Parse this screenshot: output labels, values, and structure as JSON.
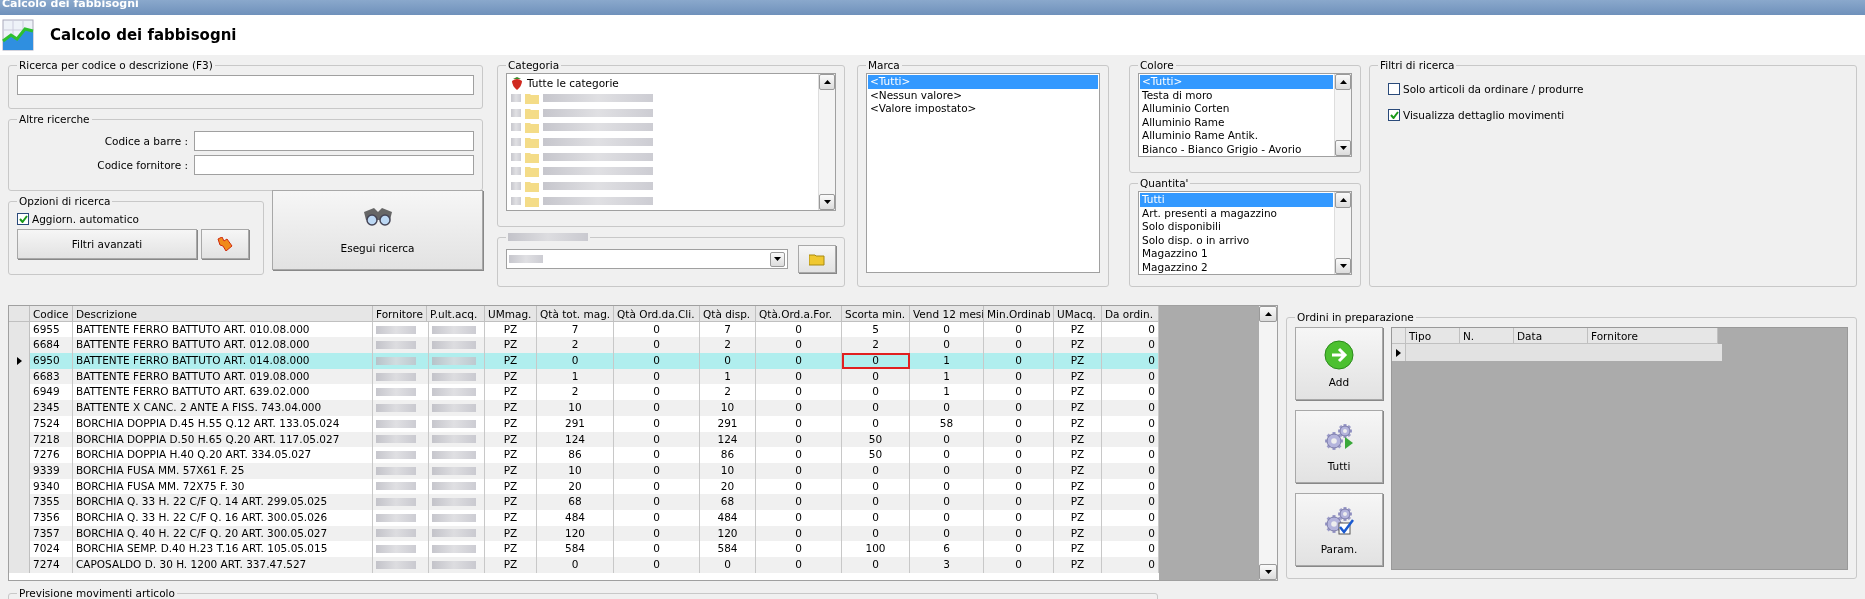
{
  "window": {
    "title": "Calcolo dei fabbisogni"
  },
  "header": {
    "title": "Calcolo dei fabbisogni"
  },
  "search": {
    "label": "Ricerca per codice o descrizione (F3)"
  },
  "other_searches": {
    "label": "Altre ricerche",
    "fields": [
      {
        "label": "Codice a barre :"
      },
      {
        "label": "Codice fornitore :"
      }
    ]
  },
  "search_options": {
    "label": "Opzioni di ricerca",
    "auto_update": {
      "label": "Aggiorn. automatico",
      "checked": true
    },
    "advanced_button": "Filtri avanzati"
  },
  "run_search_button": "Esegui ricerca",
  "category": {
    "label": "Categoria",
    "items": [
      {
        "kind": "root",
        "label": "Tutte le categorie"
      },
      {
        "kind": "redacted"
      },
      {
        "kind": "redacted"
      },
      {
        "kind": "redacted"
      },
      {
        "kind": "redacted"
      },
      {
        "kind": "redacted"
      },
      {
        "kind": "redacted"
      },
      {
        "kind": "redacted"
      },
      {
        "kind": "redacted"
      }
    ]
  },
  "brand": {
    "label": "Marca",
    "items": [
      {
        "label": "<Tutti>",
        "selected": true
      },
      {
        "label": "<Nessun valore>",
        "selected": false
      },
      {
        "label": "<Valore impostato>",
        "selected": false
      }
    ]
  },
  "color": {
    "label": "Colore",
    "items": [
      {
        "label": "<Tutti>",
        "selected": true
      },
      {
        "label": "Testa di moro",
        "selected": false
      },
      {
        "label": "Alluminio Corten",
        "selected": false
      },
      {
        "label": "Alluminio Rame",
        "selected": false
      },
      {
        "label": "Alluminio Rame Antik.",
        "selected": false
      },
      {
        "label": "Bianco - Bianco Grigio - Avorio",
        "selected": false
      }
    ]
  },
  "quantity": {
    "label": "Quantita'",
    "items": [
      {
        "label": "Tutti",
        "selected": true
      },
      {
        "label": "Art. presenti a magazzino",
        "selected": false
      },
      {
        "label": "Solo disponibili",
        "selected": false
      },
      {
        "label": "Solo disp. o in arrivo",
        "selected": false
      },
      {
        "label": "Magazzino 1",
        "selected": false
      },
      {
        "label": "Magazzino 2",
        "selected": false
      }
    ]
  },
  "search_filters": {
    "label": "Filtri di ricerca",
    "options": [
      {
        "label": "Solo articoli da ordinare / produrre",
        "checked": false
      },
      {
        "label": "Visualizza dettaglio movimenti",
        "checked": true
      }
    ]
  },
  "table": {
    "columns": [
      {
        "label": "Codice",
        "focused": false
      },
      {
        "label": "Descrizione",
        "focused": false
      },
      {
        "label": "Fornitore",
        "focused": false
      },
      {
        "label": "P.ult.acq.",
        "focused": false
      },
      {
        "label": "UMmag.",
        "focused": false
      },
      {
        "label": "Qtà tot. mag.",
        "focused": false
      },
      {
        "label": "Qtà Ord.da.Cli.",
        "focused": false
      },
      {
        "label": "Qtà disp.",
        "focused": false
      },
      {
        "label": "Qtà.Ord.a.For.",
        "focused": false
      },
      {
        "label": "Scorta min.",
        "focused": true
      },
      {
        "label": "Vend 12 mesi",
        "focused": false
      },
      {
        "label": "Min.Ordinab",
        "focused": false
      },
      {
        "label": "UMacq.",
        "focused": false
      },
      {
        "label": "Da ordin.",
        "focused": false
      }
    ],
    "rows": [
      {
        "selected": false,
        "cells": [
          "6955",
          "BATTENTE FERRO BATTUTO ART. 010.08.000",
          "",
          "",
          "PZ",
          "7",
          "0",
          "7",
          "0",
          "5",
          "0",
          "0",
          "PZ",
          "0"
        ]
      },
      {
        "selected": false,
        "cells": [
          "6684",
          "BATTENTE FERRO BATTUTO ART. 012.08.000",
          "",
          "",
          "PZ",
          "2",
          "0",
          "2",
          "0",
          "2",
          "0",
          "0",
          "PZ",
          "0"
        ]
      },
      {
        "selected": true,
        "cells": [
          "6950",
          "BATTENTE FERRO BATTUTO ART. 014.08.000",
          "",
          "",
          "PZ",
          "0",
          "0",
          "0",
          "0",
          "0",
          "1",
          "0",
          "PZ",
          "0"
        ]
      },
      {
        "selected": false,
        "cells": [
          "6683",
          "BATTENTE FERRO BATTUTO ART. 019.08.000",
          "",
          "",
          "PZ",
          "1",
          "0",
          "1",
          "0",
          "0",
          "1",
          "0",
          "PZ",
          "0"
        ]
      },
      {
        "selected": false,
        "cells": [
          "6949",
          "BATTENTE FERRO BATTUTO ART. 639.02.000",
          "",
          "",
          "PZ",
          "2",
          "0",
          "2",
          "0",
          "0",
          "1",
          "0",
          "PZ",
          "0"
        ]
      },
      {
        "selected": false,
        "cells": [
          "2345",
          "BATTENTE X CANC.  2 ANTE A FISS. 743.04.000",
          "",
          "",
          "PZ",
          "10",
          "0",
          "10",
          "0",
          "0",
          "0",
          "0",
          "PZ",
          "0"
        ]
      },
      {
        "selected": false,
        "cells": [
          "7524",
          "BORCHIA DOPPIA D.45 H.55 Q.12 ART. 133.05.024",
          "",
          "",
          "PZ",
          "291",
          "0",
          "291",
          "0",
          "0",
          "58",
          "0",
          "PZ",
          "0"
        ]
      },
      {
        "selected": false,
        "cells": [
          "7218",
          "BORCHIA DOPPIA D.50 H.65 Q.20 ART. 117.05.027",
          "",
          "",
          "PZ",
          "124",
          "0",
          "124",
          "0",
          "50",
          "0",
          "0",
          "PZ",
          "0"
        ]
      },
      {
        "selected": false,
        "cells": [
          "7276",
          "BORCHIA DOPPIA H.40 Q.20 ART. 334.05.027",
          "",
          "",
          "PZ",
          "86",
          "0",
          "86",
          "0",
          "50",
          "0",
          "0",
          "PZ",
          "0"
        ]
      },
      {
        "selected": false,
        "cells": [
          "9339",
          "BORCHIA FUSA MM. 57X61 F. 25",
          "",
          "",
          "PZ",
          "10",
          "0",
          "10",
          "0",
          "0",
          "0",
          "0",
          "PZ",
          "0"
        ]
      },
      {
        "selected": false,
        "cells": [
          "9340",
          "BORCHIA FUSA MM. 72X75 F. 30",
          "",
          "",
          "PZ",
          "20",
          "0",
          "20",
          "0",
          "0",
          "0",
          "0",
          "PZ",
          "0"
        ]
      },
      {
        "selected": false,
        "cells": [
          "7355",
          "BORCHIA Q. 33 H. 22 C/F Q. 14 ART. 299.05.025",
          "",
          "",
          "PZ",
          "68",
          "0",
          "68",
          "0",
          "0",
          "0",
          "0",
          "PZ",
          "0"
        ]
      },
      {
        "selected": false,
        "cells": [
          "7356",
          "BORCHIA Q. 33 H. 22 C/F Q. 16 ART. 300.05.026",
          "",
          "",
          "PZ",
          "484",
          "0",
          "484",
          "0",
          "0",
          "0",
          "0",
          "PZ",
          "0"
        ]
      },
      {
        "selected": false,
        "cells": [
          "7357",
          "BORCHIA Q. 40 H. 22 C/F Q. 20 ART. 300.05.027",
          "",
          "",
          "PZ",
          "120",
          "0",
          "120",
          "0",
          "0",
          "0",
          "0",
          "PZ",
          "0"
        ]
      },
      {
        "selected": false,
        "cells": [
          "7024",
          "BORCHIA SEMP. D.40 H.23 T.16 ART. 105.05.015",
          "",
          "",
          "PZ",
          "584",
          "0",
          "584",
          "0",
          "100",
          "6",
          "0",
          "PZ",
          "0"
        ]
      },
      {
        "selected": false,
        "cells": [
          "7274",
          "CAPOSALDO D. 30 H. 1200 ART. 337.47.527",
          "",
          "",
          "PZ",
          "0",
          "0",
          "0",
          "0",
          "0",
          "3",
          "0",
          "PZ",
          "0"
        ]
      }
    ]
  },
  "orders": {
    "label": "Ordini in preparazione",
    "buttons": [
      {
        "kind": "add",
        "label": "Add"
      },
      {
        "kind": "all",
        "label": "Tutti"
      },
      {
        "kind": "params",
        "label": "Param."
      }
    ],
    "columns": [
      "Tipo",
      "N.",
      "Data",
      "Fornitore"
    ]
  },
  "forecast": {
    "label": "Previsione movimenti articolo"
  }
}
